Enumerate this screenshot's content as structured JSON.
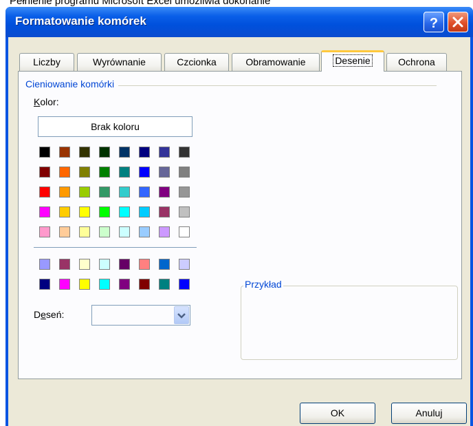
{
  "window": {
    "title": "Formatowanie komórek",
    "top_caption": "Pełnienie programu Microsoft Excel umożliwia dokonanie"
  },
  "tabs": [
    {
      "label": "Liczby",
      "active": false
    },
    {
      "label": "Wyrównanie",
      "active": false
    },
    {
      "label": "Czcionka",
      "active": false
    },
    {
      "label": "Obramowanie",
      "active": false
    },
    {
      "label": "Desenie",
      "active": true
    },
    {
      "label": "Ochrona",
      "active": false
    }
  ],
  "shading": {
    "group_title": "Cieniowanie komórki",
    "color_label_first": "K",
    "color_label_rest": "olor:",
    "no_color_button": "Brak koloru",
    "palette_main": [
      [
        "#000000",
        "#993300",
        "#333300",
        "#003300",
        "#003366",
        "#000080",
        "#333399",
        "#333333"
      ],
      [
        "#800000",
        "#FF6600",
        "#808000",
        "#008000",
        "#008080",
        "#0000FF",
        "#666699",
        "#808080"
      ],
      [
        "#FF0000",
        "#FF9900",
        "#99CC00",
        "#339966",
        "#33CCCC",
        "#3366FF",
        "#800080",
        "#969696"
      ],
      [
        "#FF00FF",
        "#FFCC00",
        "#FFFF00",
        "#00FF00",
        "#00FFFF",
        "#00CCFF",
        "#993366",
        "#C0C0C0"
      ],
      [
        "#FF99CC",
        "#FFCC99",
        "#FFFF99",
        "#CCFFCC",
        "#CCFFFF",
        "#99CCFF",
        "#CC99FF",
        "#FFFFFF"
      ]
    ],
    "palette_extra": [
      [
        "#9999FF",
        "#993366",
        "#FFFFCC",
        "#CCFFFF",
        "#660066",
        "#FF8080",
        "#0066CC",
        "#CCCCFF"
      ],
      [
        "#000080",
        "#FF00FF",
        "#FFFF00",
        "#00FFFF",
        "#800080",
        "#800000",
        "#008080",
        "#0000FF"
      ]
    ],
    "pattern_label_pre": "D",
    "pattern_label_under": "e",
    "pattern_label_post": "seń:",
    "pattern_value": ""
  },
  "sample": {
    "title": "Przykład"
  },
  "buttons": {
    "ok": "OK",
    "cancel": "Anuluj"
  },
  "icons": {
    "help": "help-icon",
    "close": "close-icon",
    "dropdown": "chevron-down-icon"
  }
}
